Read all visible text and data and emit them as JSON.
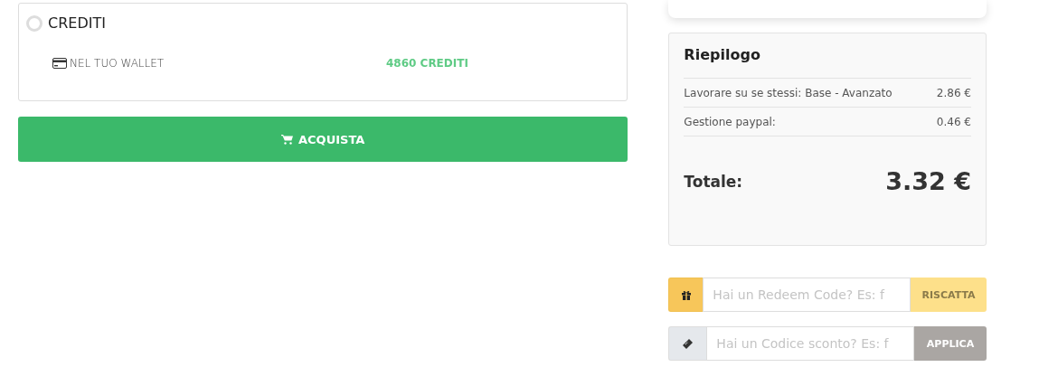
{
  "payment": {
    "option": {
      "label": "CREDITI",
      "selected": false
    },
    "wallet": {
      "label": "NEL TUO WALLET",
      "value": "4860 CREDITI"
    }
  },
  "buy_button": {
    "label": "ACQUISTA"
  },
  "summary": {
    "title": "Riepilogo",
    "items": [
      {
        "label": "Lavorare su se stessi: Base - Avanzato",
        "amount": "2.86 €"
      },
      {
        "label": "Gestione paypal:",
        "amount": "0.46 €"
      }
    ],
    "total_label": "Totale:",
    "total": "3.32 €"
  },
  "codes": [
    {
      "kind": "redeem",
      "placeholder": "Hai un Redeem Code? Es: f",
      "button": "RISCATTA"
    },
    {
      "kind": "discount",
      "placeholder": "Hai un Codice sconto? Es: f",
      "button": "APPLICA"
    }
  ]
}
